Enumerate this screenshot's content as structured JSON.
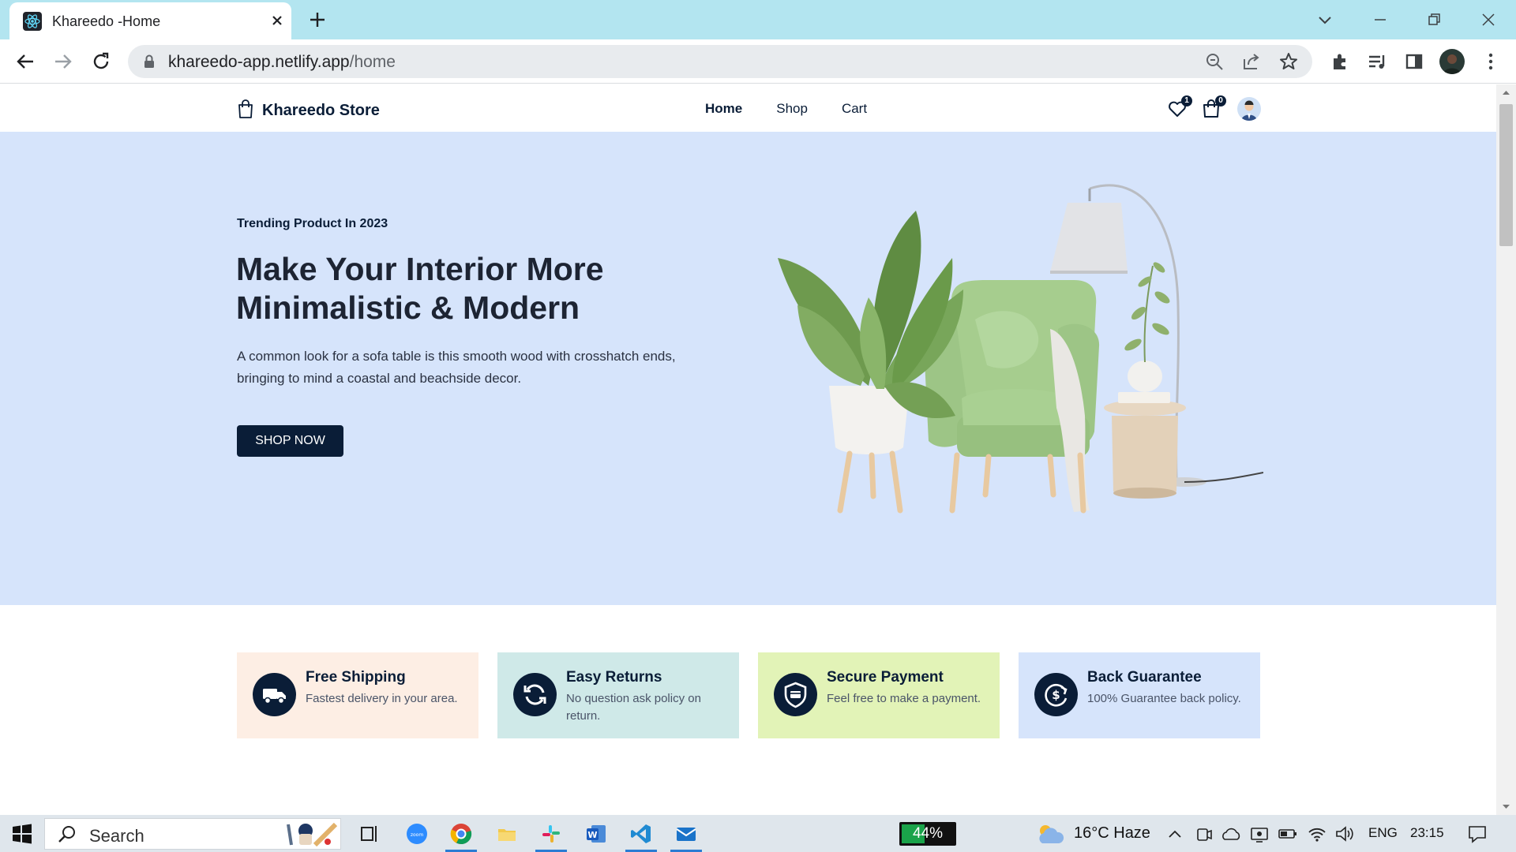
{
  "browser": {
    "tab_title": "Khareedo -Home",
    "url_host": "khareedo-app.netlify.app",
    "url_path": "/home"
  },
  "site": {
    "brand": "Khareedo Store",
    "nav": [
      "Home",
      "Shop",
      "Cart"
    ],
    "wishlist_count": "1",
    "cart_count": "0"
  },
  "hero": {
    "subtitle": "Trending Product In 2023",
    "title_line1": "Make Your Interior More",
    "title_line2": "Minimalistic & Modern",
    "description_line1": "A common look for a sofa table is this smooth wood with crosshatch ends,",
    "description_line2": "bringing to mind a coastal and beachside decor.",
    "button": "SHOP NOW"
  },
  "services": [
    {
      "title": "Free Shipping",
      "desc": "Fastest delivery in your area.",
      "bg": "#fdeee4",
      "icon": "truck-icon"
    },
    {
      "title": "Easy Returns",
      "desc": "No question ask policy on return.",
      "bg": "#cfe9e8",
      "icon": "refresh-icon"
    },
    {
      "title": "Secure Payment",
      "desc": "Feel free to make a payment.",
      "bg": "#e2f3b7",
      "icon": "shield-card-icon"
    },
    {
      "title": "Back Guarantee",
      "desc": "100% Guarantee back policy.",
      "bg": "#d6e4fb",
      "icon": "money-back-icon"
    }
  ],
  "colors": {
    "hero_bg": "#d6e4fb",
    "primary": "#0a1d37",
    "tabbar": "#b3e5f0"
  },
  "taskbar": {
    "search_label": "Search",
    "battery": "44%",
    "battery_level": 0.44,
    "weather": "16°C  Haze",
    "language": "ENG",
    "time": "23:15"
  }
}
